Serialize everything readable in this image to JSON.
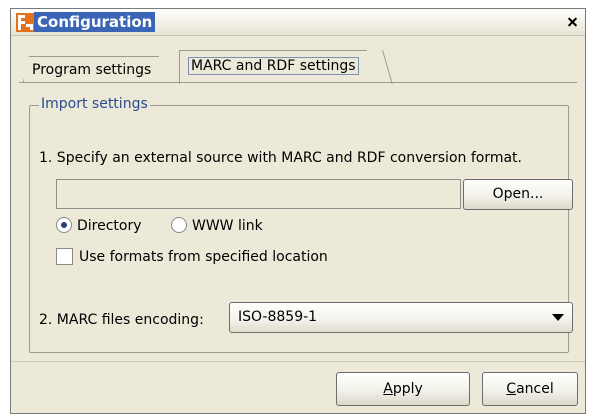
{
  "window": {
    "title": "Configuration",
    "close_glyph": "×"
  },
  "tabs": [
    {
      "label": "Program settings",
      "selected": false
    },
    {
      "label": "MARC and RDF settings",
      "selected": true
    }
  ],
  "import_settings": {
    "group_title": "Import settings",
    "instruction": "1. Specify an external source with MARC and RDF conversion format.",
    "path_value": "",
    "open_button": "Open...",
    "radio_directory": {
      "label": "Directory",
      "checked": true
    },
    "radio_www": {
      "label": "WWW link",
      "checked": false
    },
    "checkbox": {
      "label": "Use formats from specified location",
      "checked": false
    },
    "encoding_label": "2. MARC files encoding:",
    "encoding_value": "ISO-8859-1"
  },
  "footer": {
    "apply_mnemonic": "A",
    "apply_rest": "pply",
    "cancel_mnemonic": "C",
    "cancel_rest": "ancel"
  },
  "colors": {
    "title_highlight": "#3a64b6",
    "group_title": "#2a4b8f",
    "dialog_bg": "#ece9d8"
  },
  "icons": {
    "app": "configuration-app-icon",
    "close": "close-icon",
    "dropdown": "chevron-down-icon"
  }
}
